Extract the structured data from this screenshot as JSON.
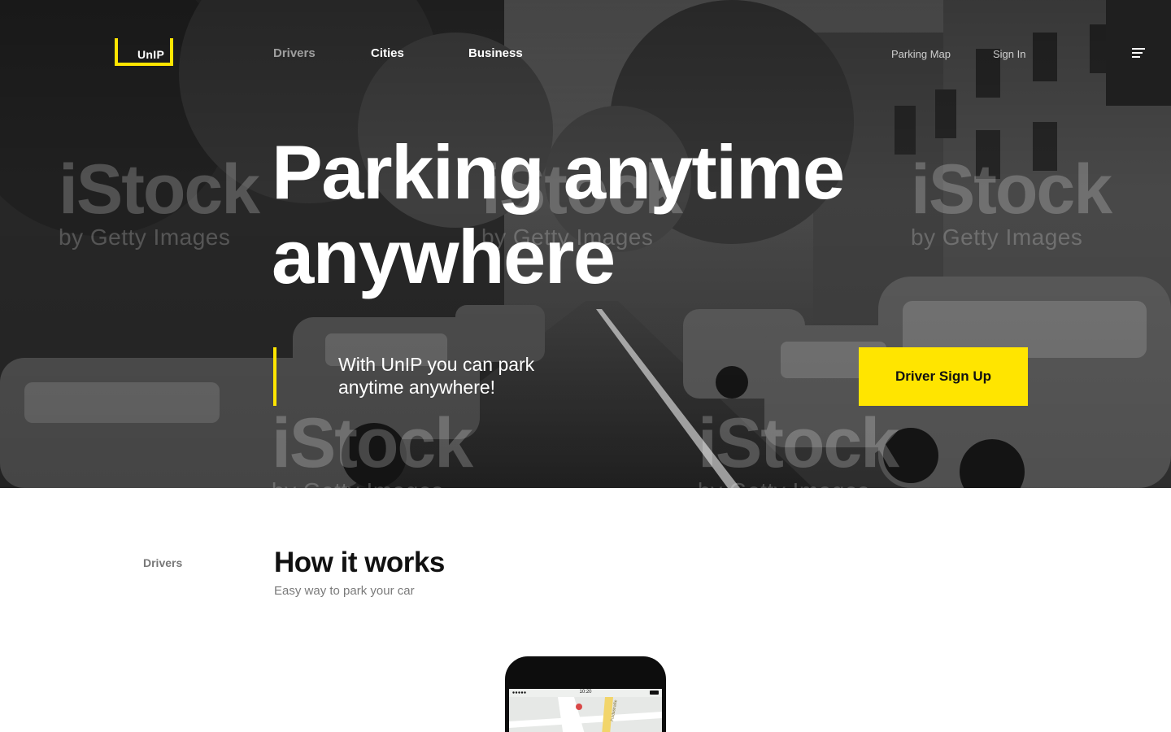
{
  "brand": {
    "name": "UnIP",
    "accent": "#FFE500"
  },
  "nav": {
    "primary": [
      {
        "label": "Drivers",
        "state": "muted"
      },
      {
        "label": "Cities",
        "state": "default"
      },
      {
        "label": "Business",
        "state": "default"
      }
    ],
    "secondary": [
      {
        "label": "Parking Map"
      },
      {
        "label": "Sign In"
      }
    ],
    "menu_icon": "hamburger-icon"
  },
  "watermark": {
    "line1": "iStock",
    "line2": "by Getty Images"
  },
  "hero": {
    "title_line1": "Parking anytime",
    "title_line2": "anywhere",
    "subtitle": "With UnIP you can park anytime anywhere!",
    "cta_label": "Driver Sign Up"
  },
  "section": {
    "label": "Drivers",
    "title": "How it works",
    "subtitle": "Easy way to park your car"
  },
  "phone": {
    "time": "10:20",
    "map_street": "Fuldastraße"
  }
}
